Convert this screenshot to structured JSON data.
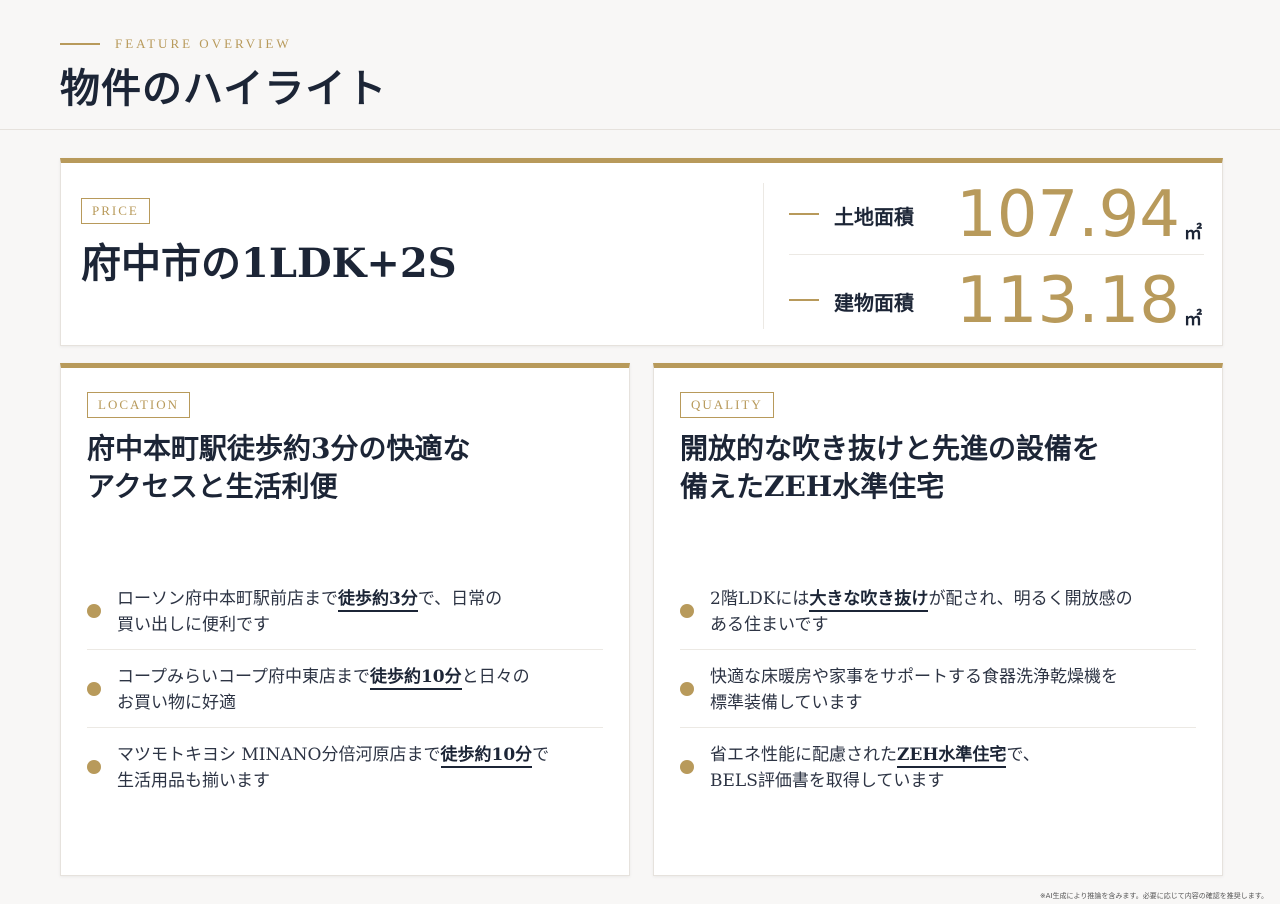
{
  "header": {
    "eyebrow": "FEATURE OVERVIEW",
    "title": "物件のハイライト"
  },
  "price": {
    "tag": "PRICE",
    "title": "府中市の1LDK+2S",
    "areas": [
      {
        "label": "土地面積",
        "value": "107.94",
        "unit": "㎡"
      },
      {
        "label": "建物面積",
        "value": "113.18",
        "unit": "㎡"
      }
    ]
  },
  "location": {
    "tag": "LOCATION",
    "title_lines": [
      "府中本町駅徒歩約3分の快適な",
      "アクセスと生活利便"
    ],
    "items": [
      {
        "l1_pre": "ローソン府中本町駅前店まで",
        "l1_hl": "徒歩約3分",
        "l1_post": "で、日常の",
        "l2": "買い出しに便利です"
      },
      {
        "l1_pre": "コープみらいコープ府中東店まで",
        "l1_hl": "徒歩約10分",
        "l1_post": "と日々の",
        "l2": "お買い物に好適"
      },
      {
        "l1_pre": "マツモトキヨシ MINANO分倍河原店まで",
        "l1_hl": "徒歩約10分",
        "l1_post": "で",
        "l2": "生活用品も揃います"
      }
    ]
  },
  "quality": {
    "tag": "QUALITY",
    "title_lines": [
      "開放的な吹き抜けと先進の設備を",
      "備えたZEH水準住宅"
    ],
    "items": [
      {
        "l1_pre": "2階LDKには",
        "l1_hl": "大きな吹き抜け",
        "l1_post": "が配され、明るく開放感の",
        "l2": "ある住まいです"
      },
      {
        "l1_pre": "快適な床暖房や家事をサポートする食器洗浄乾燥機を",
        "l1_hl": "",
        "l1_post": "",
        "l2": "標準装備しています"
      },
      {
        "l1_pre": "省エネ性能に配慮された",
        "l1_hl": "ZEH水準住宅",
        "l1_post": "で、",
        "l2": "BELS評価書を取得しています"
      }
    ]
  },
  "footnote": "※AI生成により推論を含みます。必要に応じて内容の確認を推奨します。",
  "colors": {
    "accent": "#b89a5b",
    "navy": "#1c2536"
  }
}
